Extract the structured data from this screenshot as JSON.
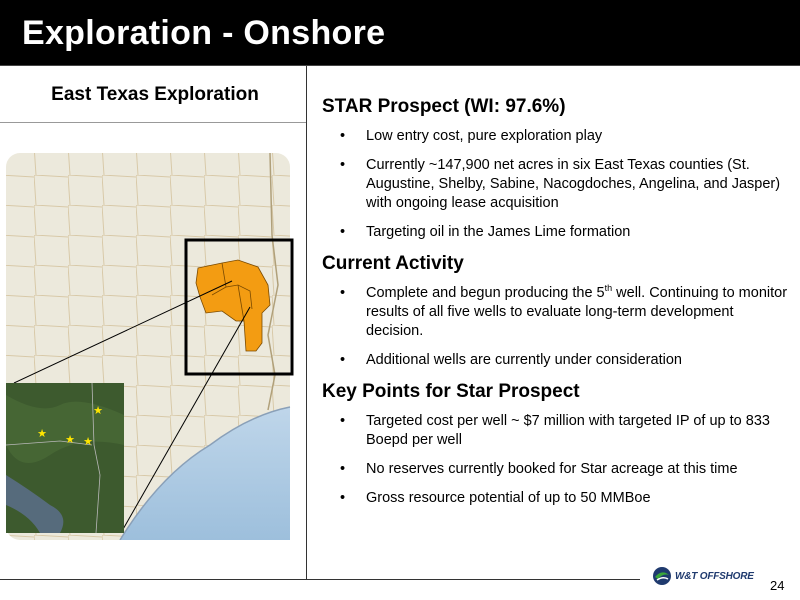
{
  "header": {
    "title": "Exploration - Onshore"
  },
  "left_panel": {
    "title": "East Texas Exploration"
  },
  "sections": [
    {
      "title": "STAR Prospect (WI: 97.6%)",
      "bullets": [
        "Low entry cost, pure exploration play",
        "Currently ~147,900 net acres in six East Texas counties (St. Augustine, Shelby, Sabine, Nacogdoches, Angelina, and Jasper) with ongoing lease acquisition",
        "Targeting oil in the James Lime formation"
      ]
    },
    {
      "title": "Current Activity",
      "bullets": [
        {
          "pre": "Complete and begun producing the 5",
          "sup": "th",
          "post": " well.  Continuing to monitor results of all five wells to evaluate long-term development decision."
        },
        "Additional wells are currently under consideration"
      ]
    },
    {
      "title": "Key Points for Star Prospect",
      "bullets": [
        "Targeted cost per well ~ $7 million with targeted IP of up to 833 Boepd per well",
        "No reserves currently booked for Star acreage at this time",
        "Gross resource potential of up to 50 MMBoe"
      ]
    }
  ],
  "bullet_glyph": "•",
  "footer": {
    "page_number": "24",
    "logo_text": "W&T OFFSHORE"
  },
  "colors": {
    "acreage": "#f39c12",
    "title_bar": "#000000",
    "logo_blue": "#1f3a6e",
    "logo_green": "#3aa63a"
  }
}
